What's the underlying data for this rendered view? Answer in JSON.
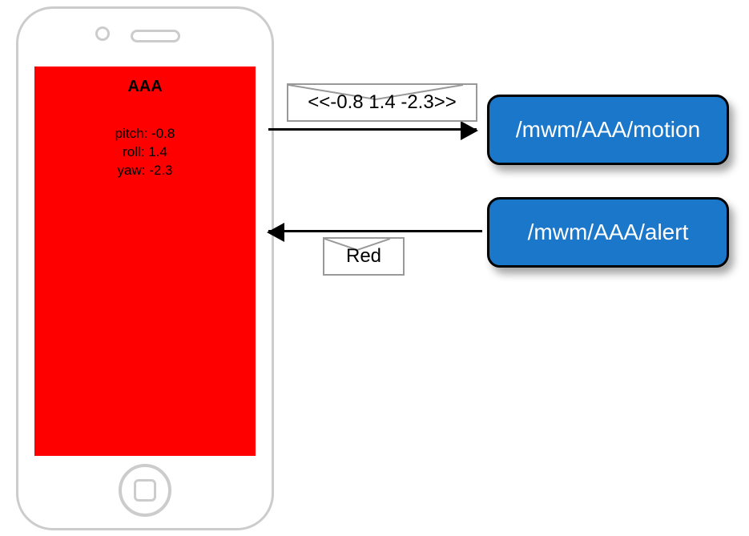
{
  "phone": {
    "title": "AAA",
    "readings": {
      "pitch_label": "pitch:",
      "pitch_value": "-0.8",
      "roll_label": "roll:",
      "roll_value": "1.4",
      "yaw_label": "yaw:",
      "yaw_value": "-2.3"
    },
    "screen_color": "#FF0000"
  },
  "messages": {
    "motion_payload": "<<-0.8 1.4 -2.3>>",
    "alert_payload": "Red"
  },
  "topics": {
    "motion": "/mwm/AAA/motion",
    "alert": "/mwm/AAA/alert"
  }
}
